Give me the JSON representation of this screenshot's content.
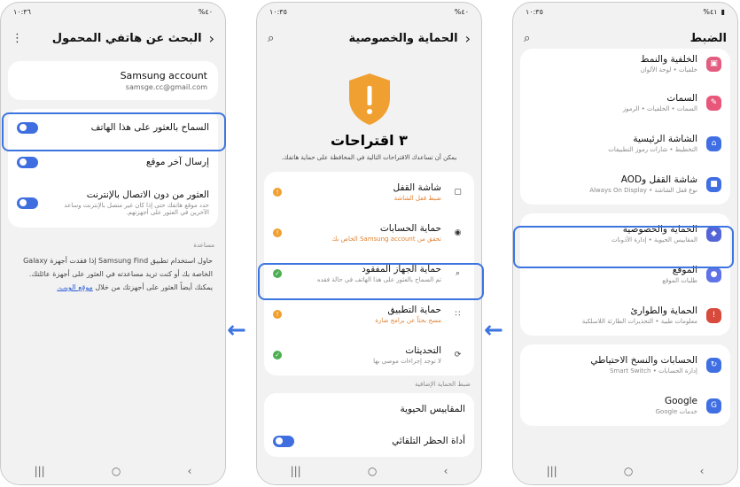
{
  "phone_right": {
    "status": {
      "time": "١٠:٣٥",
      "battery": "%٤١"
    },
    "title": "الضبط",
    "items": [
      {
        "title": "الخلفية والنمط",
        "sub": "خلفيات • لوحة الألوان",
        "color": "#e35d80",
        "icon": "wallpaper-icon"
      },
      {
        "title": "السمات",
        "sub": "السمات • الخلفيات • الرموز",
        "color": "#e8577a",
        "icon": "themes-icon"
      },
      {
        "title": "الشاشة الرئيسية",
        "sub": "التخطيط • شارات رموز التطبيقات",
        "color": "#3f6fe2",
        "icon": "home-icon"
      },
      {
        "title": "شاشة القفل وAOD",
        "sub": "نوع قفل الشاشة • Always On Display",
        "color": "#3f6fe2",
        "icon": "lock-icon"
      },
      {
        "title": "الحماية والخصوصية",
        "sub": "المقاييس الحيوية • إدارة الأذونات",
        "color": "#5565d8",
        "icon": "shield-icon"
      },
      {
        "title": "الموقع",
        "sub": "طلبات الموقع",
        "color": "#5f72e6",
        "icon": "location-icon"
      },
      {
        "title": "الحماية والطوارئ",
        "sub": "معلومات طبية • التحذيرات الطارئة اللاسلكية",
        "color": "#d84a3c",
        "icon": "emergency-icon"
      },
      {
        "title": "الحسابات والنسخ الاحتياطي",
        "sub": "إدارة الحسابات • Smart Switch",
        "color": "#3f6fe2",
        "icon": "sync-icon"
      },
      {
        "title": "Google",
        "sub": "خدمات Google",
        "color": "#3f6fe2",
        "icon": "google-icon"
      }
    ]
  },
  "phone_middle": {
    "status": {
      "time": "١٠:٣٥",
      "battery": "%٤٠"
    },
    "title": "الحماية والخصوصية",
    "suggestions_title": "٣ اقتراحات",
    "suggestions_desc": "يمكن أن تساعدك الاقتراحات التالية في المحافظة على حماية هاتفك.",
    "items": [
      {
        "title": "شاشة القفل",
        "sub": "ضبط قفل الشاشة",
        "status": "warn",
        "icon": "lock-icon"
      },
      {
        "title": "حماية الحسابات",
        "sub": "تحقق من Samsung account الخاص بك",
        "status": "warn",
        "icon": "account-icon"
      },
      {
        "title": "حماية الجهاز المفقود",
        "sub": "تم السماح بالعثور على هذا الهاتف في حالة فقده",
        "status": "ok",
        "icon": "find-device-icon"
      },
      {
        "title": "حماية التطبيق",
        "sub": "مسح بحثاً عن برامج ضارة",
        "status": "warn",
        "icon": "apps-icon"
      },
      {
        "title": "التحديثات",
        "sub": "لا توجد إجراءات موصى بها",
        "status": "ok",
        "icon": "update-icon"
      }
    ],
    "extra_header": "ضبط الحماية الإضافية",
    "extra_items": [
      {
        "title": "المقاييس الحيوية"
      },
      {
        "title": "أداة الحظر التلقائي"
      }
    ]
  },
  "phone_left": {
    "status": {
      "time": "١٠:٣٦",
      "battery": "%٤٠"
    },
    "title": "البحث عن هاتفي المحمول",
    "account": {
      "name": "Samsung account",
      "email": "samsge.cc@gmail.com"
    },
    "toggles": [
      {
        "title": "السماح بالعثور على هذا الهاتف",
        "sub": ""
      },
      {
        "title": "إرسال آخر موقع",
        "sub": ""
      },
      {
        "title": "العثور من دون الاتصال بالإنترنت",
        "sub": "حدد موقع هاتفك حتى إذا كان غير متصل بالإنترنت وساعد الآخرين في العثور على أجهزتهم."
      }
    ],
    "help_header": "مساعدة",
    "help_text": "حاول استخدام تطبيق Samsung Find إذا فقدت أجهزة Galaxy الخاصة بك أو كنت تريد مساعدته في العثور على أجهزة عائلتك. يمكنك أيضاً العثور على أجهزتك من خلال",
    "help_link": "موقع الويب."
  },
  "colors": {
    "accent": "#3c74e0",
    "warn": "#f0a030",
    "ok": "#4caf50"
  }
}
